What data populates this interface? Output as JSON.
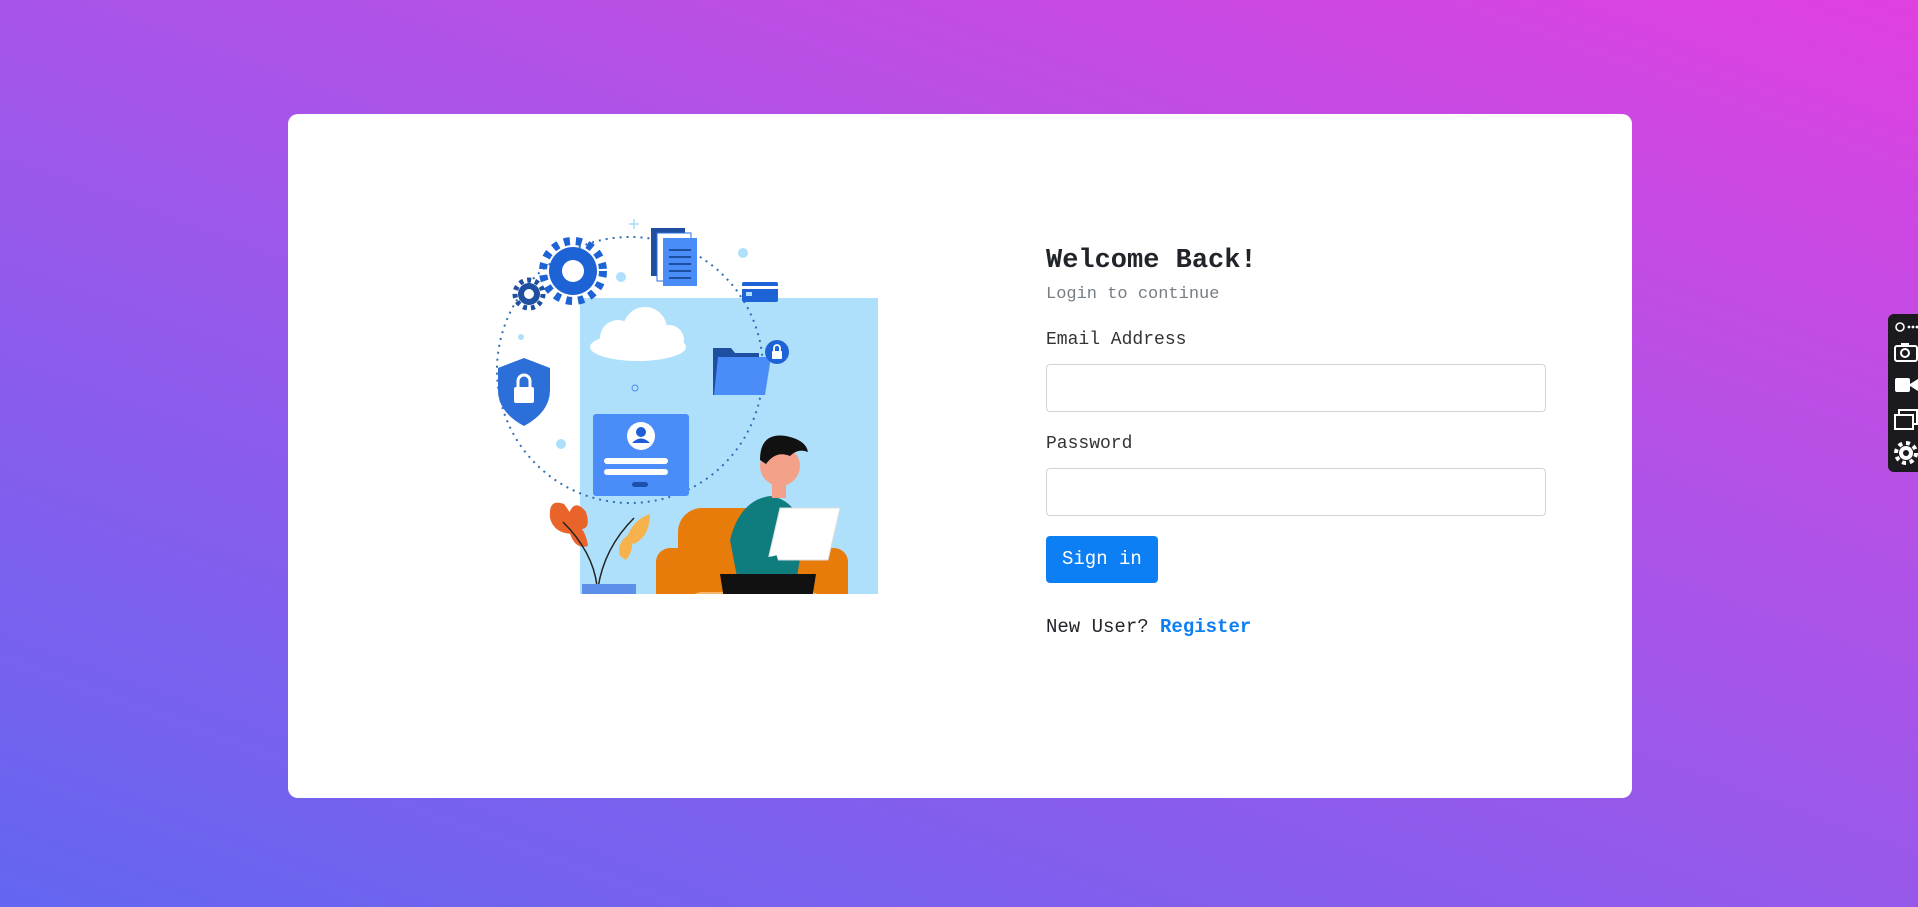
{
  "login": {
    "title": "Welcome Back!",
    "subtitle": "Login to continue",
    "email_label": "Email Address",
    "email_value": "",
    "password_label": "Password",
    "password_value": "",
    "signin_label": "Sign in",
    "new_user_text": "New User?",
    "register_label": "Register"
  },
  "colors": {
    "accent": "#0d7ff5",
    "background_start": "#e040e0",
    "background_end": "#6366f1"
  },
  "toolbar": {
    "icons": [
      "link-dots-icon",
      "camera-icon",
      "video-icon",
      "window-icon",
      "gear-icon"
    ]
  }
}
